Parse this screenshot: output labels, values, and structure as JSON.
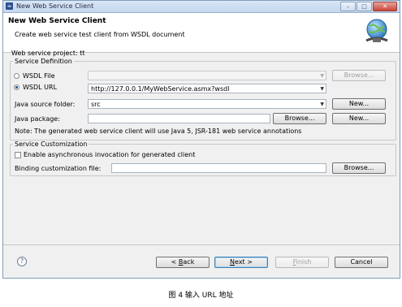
{
  "window": {
    "title": "New Web Service Client",
    "controls": {
      "minimize": "–",
      "maximize": "□",
      "close": "✕"
    }
  },
  "banner": {
    "title": "New Web Service Client",
    "description": "Create web service test client from WSDL document",
    "icon": "web-service-globe-icon"
  },
  "project": {
    "label": "Web service project: tt"
  },
  "service_definition": {
    "legend": "Service Definition",
    "wsdl_file_label": "WSDL File",
    "wsdl_file_value": "",
    "wsdl_file_browse": "Browse...",
    "wsdl_url_label": "WSDL URL",
    "wsdl_url_value": "http://127.0.0.1/MyWebService.asmx?wsdl",
    "selected": "WSDL URL"
  },
  "source": {
    "java_source_folder_label": "Java source folder:",
    "java_source_folder_value": "src",
    "new_button": "New...",
    "java_package_label": "Java package:",
    "java_package_value": "",
    "browse_button": "Browse...",
    "new_package_button": "New...",
    "note": "Note: The generated web service client will use Java 5, JSR-181 web service annotations"
  },
  "customization": {
    "legend": "Service Customization",
    "async_label": "Enable asynchronous invocation for generated client",
    "async_checked": false,
    "binding_label": "Binding customization file:",
    "binding_value": "",
    "browse_button": "Browse..."
  },
  "footer": {
    "help_icon": "help-icon",
    "help_glyph": "?",
    "back_prefix": "< ",
    "back_mnemonic": "B",
    "back_rest": "ack",
    "next_mnemonic": "N",
    "next_rest": "ext >",
    "finish_mnemonic": "F",
    "finish_rest": "inish",
    "cancel": "Cancel"
  },
  "caption": "图 4    输入 URL 地址"
}
